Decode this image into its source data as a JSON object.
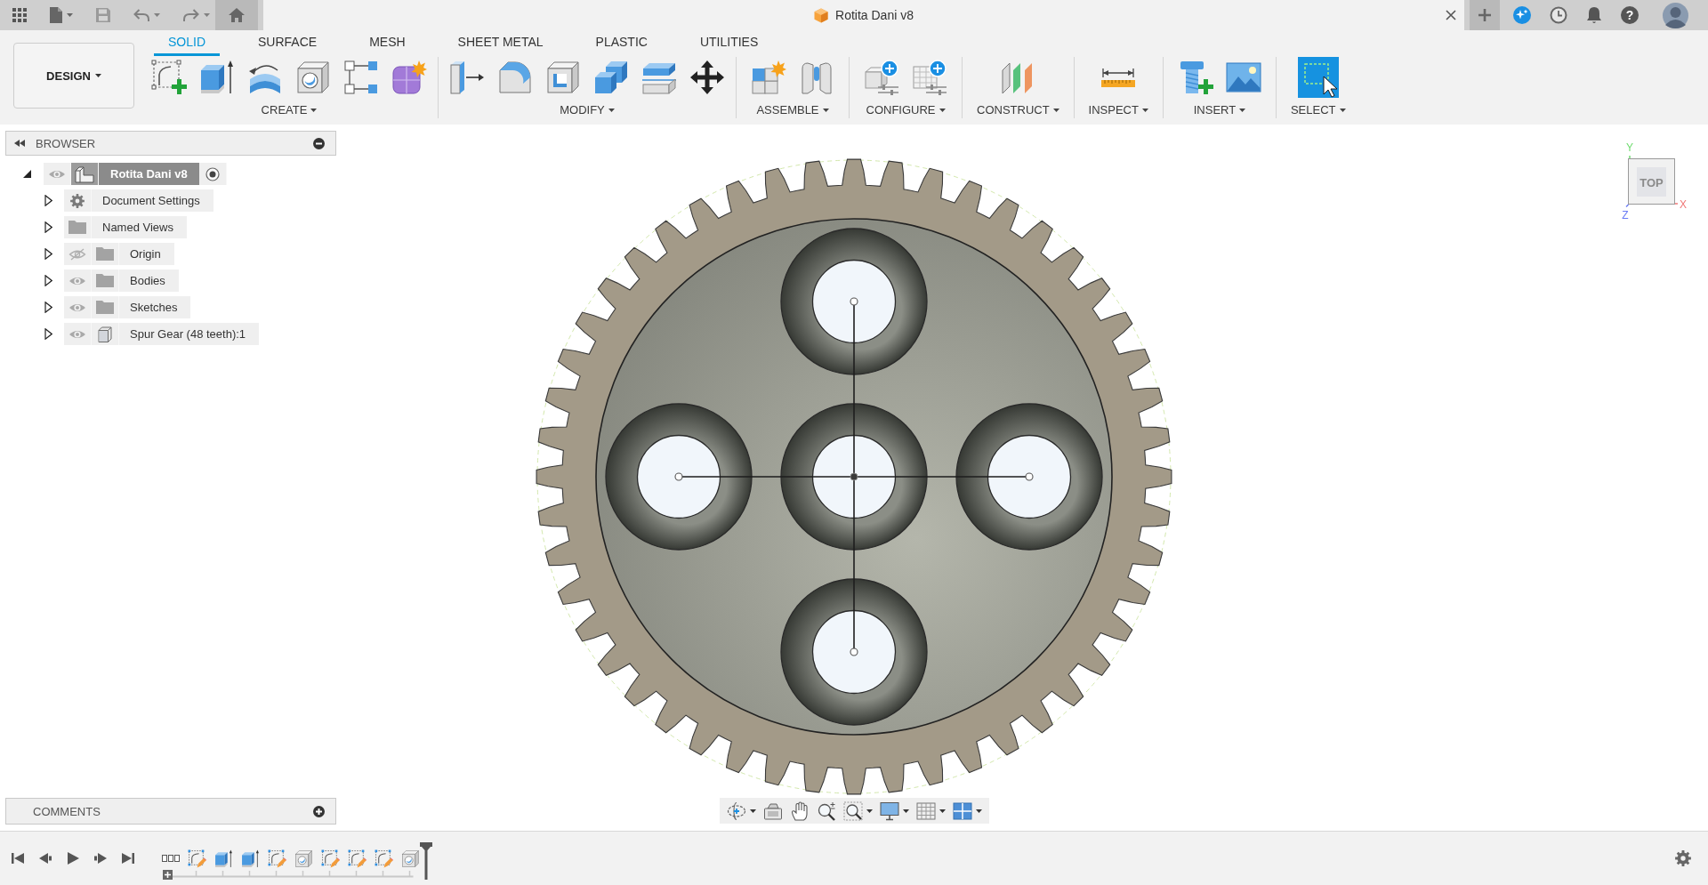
{
  "title_bar": {
    "document_title": "Rotita Dani v8",
    "help_label": "?"
  },
  "toolbar": {
    "workspace": "DESIGN",
    "tabs": [
      {
        "label": "SOLID",
        "selected": true
      },
      {
        "label": "SURFACE",
        "selected": false
      },
      {
        "label": "MESH",
        "selected": false
      },
      {
        "label": "SHEET METAL",
        "selected": false
      },
      {
        "label": "PLASTIC",
        "selected": false
      },
      {
        "label": "UTILITIES",
        "selected": false
      }
    ],
    "groups": [
      {
        "label": "CREATE",
        "tools": [
          {
            "kind": "sketch"
          },
          {
            "kind": "extrude"
          },
          {
            "kind": "revolve"
          },
          {
            "kind": "hole"
          },
          {
            "kind": "pattern"
          },
          {
            "kind": "form"
          }
        ]
      },
      {
        "label": "MODIFY",
        "tools": [
          {
            "kind": "press-pull"
          },
          {
            "kind": "fillet"
          },
          {
            "kind": "shell"
          },
          {
            "kind": "combine"
          },
          {
            "kind": "split"
          },
          {
            "kind": "move"
          }
        ]
      },
      {
        "label": "ASSEMBLE",
        "tools": [
          {
            "kind": "component"
          },
          {
            "kind": "joint"
          }
        ]
      },
      {
        "label": "CONFIGURE",
        "tools": [
          {
            "kind": "configure"
          },
          {
            "kind": "table"
          }
        ]
      },
      {
        "label": "CONSTRUCT",
        "tools": [
          {
            "kind": "plane"
          }
        ]
      },
      {
        "label": "INSPECT",
        "tools": [
          {
            "kind": "measure"
          }
        ]
      },
      {
        "label": "INSERT",
        "tools": [
          {
            "kind": "fastener"
          },
          {
            "kind": "image"
          }
        ]
      },
      {
        "label": "SELECT",
        "tools": [
          {
            "kind": "select"
          }
        ]
      }
    ]
  },
  "browser": {
    "title": "BROWSER",
    "root": {
      "label": "Rotita Dani v8",
      "expanded": true,
      "visible": true,
      "active": true,
      "children": [
        {
          "label": "Document Settings",
          "kind": "settings",
          "expanded": false
        },
        {
          "label": "Named Views",
          "kind": "folder",
          "expanded": false
        },
        {
          "label": "Origin",
          "kind": "folder",
          "visible": false,
          "expanded": false
        },
        {
          "label": "Bodies",
          "kind": "folder",
          "visible": true,
          "expanded": false
        },
        {
          "label": "Sketches",
          "kind": "folder",
          "visible": true,
          "expanded": false
        },
        {
          "label": "Spur Gear (48 teeth):1",
          "kind": "component",
          "visible": true,
          "expanded": false
        }
      ]
    }
  },
  "viewcube": {
    "face": "TOP",
    "axes": [
      {
        "label": "Y",
        "color": "#6fdc6f"
      },
      {
        "label": "X",
        "color": "#f07878"
      },
      {
        "label": "Z",
        "color": "#6a7cf5"
      }
    ]
  },
  "comments": {
    "title": "COMMENTS"
  },
  "timeline": {
    "features": [
      {
        "kind": "sketch"
      },
      {
        "kind": "extrude"
      },
      {
        "kind": "extrude"
      },
      {
        "kind": "sketch"
      },
      {
        "kind": "hole"
      },
      {
        "kind": "sketch"
      },
      {
        "kind": "sketch"
      },
      {
        "kind": "sketch"
      },
      {
        "kind": "hole"
      }
    ]
  }
}
